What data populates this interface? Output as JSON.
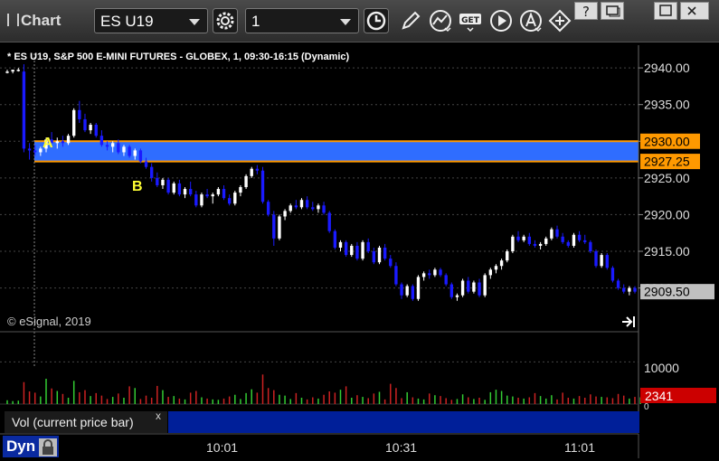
{
  "app": {
    "title": "Chart"
  },
  "toolbar": {
    "symbol": "ES U19",
    "interval": "1",
    "icons": [
      "gear-icon",
      "clock-icon",
      "pencil-icon",
      "line-study-icon",
      "get-icon",
      "play-icon",
      "a-alert-icon",
      "move-icon"
    ]
  },
  "window_controls": [
    "help-icon",
    "restore-icon",
    "maximize-icon",
    "close-icon"
  ],
  "chart": {
    "header": "* ES U19, S&P 500 E-MINI FUTURES - GLOBEX, 1, 09:30-16:15 (Dynamic)",
    "copyright": "© eSignal, 2019",
    "price_ticks": [
      "2940.00",
      "2935.00",
      "2930.00",
      "2925.00",
      "2920.00",
      "2915.00",
      "2910.00"
    ],
    "hline_upper": "2930.00",
    "hline_lower": "2927.25",
    "last_price": "2909.50",
    "annotation_a": "A",
    "annotation_b": "B",
    "time_ticks": [
      "10:01",
      "10:31",
      "11:01"
    ],
    "volume_tick": "10000",
    "volume_zero": "0",
    "last_volume": "2341",
    "volume_label": "Vol (current price bar)",
    "volume_close": "x",
    "dyn_label": "Dyn",
    "colors": {
      "up_candle": "#ffffff",
      "down_candle": "#1a1aff",
      "zone": "#2f6dff",
      "hline": "#ff9900",
      "vol_up": "#33cc33",
      "vol_down": "#cc2222",
      "last_price_badge": "#c0c0c0",
      "last_volume_badge": "#cc0000"
    }
  },
  "chart_data": {
    "type": "candlestick",
    "title": "* ES U19, S&P 500 E-MINI FUTURES - GLOBEX, 1, 09:30-16:15 (Dynamic)",
    "ylim": [
      2906.5,
      2941
    ],
    "price_ticks": [
      2910,
      2915,
      2920,
      2925,
      2930,
      2935,
      2940
    ],
    "horizontal_lines": [
      2930.0,
      2927.25
    ],
    "last_price": 2909.5,
    "time_ticks": [
      "10:01",
      "10:31",
      "11:01"
    ],
    "candles": [
      [
        2939.5,
        2939.75,
        2939.25,
        2939.5
      ],
      [
        2939.5,
        2939.75,
        2939.25,
        2939.75
      ],
      [
        2939.75,
        2940.0,
        2939.5,
        2939.75
      ],
      [
        2939.5,
        2940.5,
        2928.5,
        2929.0
      ],
      [
        2929.0,
        2929.75,
        2927.5,
        2928.75
      ],
      [
        2928.75,
        2929.5,
        2928.0,
        2928.5
      ],
      [
        2928.5,
        2929.25,
        2928.0,
        2929.0
      ],
      [
        2929.0,
        2930.5,
        2928.5,
        2930.25
      ],
      [
        2930.25,
        2931.25,
        2929.75,
        2929.75
      ],
      [
        2929.75,
        2930.5,
        2929.0,
        2930.0
      ],
      [
        2930.0,
        2930.75,
        2929.25,
        2929.75
      ],
      [
        2929.75,
        2931.0,
        2929.5,
        2930.75
      ],
      [
        2930.75,
        2934.5,
        2930.5,
        2934.25
      ],
      [
        2934.25,
        2935.5,
        2932.5,
        2933.0
      ],
      [
        2933.0,
        2933.75,
        2931.25,
        2931.5
      ],
      [
        2931.5,
        2932.5,
        2931.0,
        2932.25
      ],
      [
        2932.25,
        2932.5,
        2930.5,
        2930.75
      ],
      [
        2930.75,
        2931.5,
        2929.25,
        2929.5
      ],
      [
        2929.5,
        2930.0,
        2928.75,
        2929.25
      ],
      [
        2929.25,
        2930.0,
        2928.5,
        2929.75
      ],
      [
        2929.75,
        2930.25,
        2928.25,
        2928.5
      ],
      [
        2928.5,
        2929.5,
        2928.0,
        2929.25
      ],
      [
        2929.25,
        2929.5,
        2927.75,
        2928.0
      ],
      [
        2928.0,
        2929.0,
        2927.5,
        2928.75
      ],
      [
        2928.75,
        2929.0,
        2927.0,
        2927.25
      ],
      [
        2927.25,
        2927.75,
        2926.25,
        2926.5
      ],
      [
        2926.5,
        2927.0,
        2924.5,
        2925.0
      ],
      [
        2925.0,
        2925.75,
        2923.75,
        2924.0
      ],
      [
        2924.0,
        2925.0,
        2923.5,
        2924.75
      ],
      [
        2924.75,
        2925.0,
        2922.75,
        2923.0
      ],
      [
        2923.0,
        2924.5,
        2922.75,
        2924.25
      ],
      [
        2924.25,
        2924.75,
        2922.5,
        2922.75
      ],
      [
        2922.75,
        2923.75,
        2922.25,
        2923.5
      ],
      [
        2923.5,
        2924.5,
        2922.5,
        2922.75
      ],
      [
        2922.75,
        2923.25,
        2921.0,
        2921.25
      ],
      [
        2921.25,
        2923.0,
        2921.0,
        2922.75
      ],
      [
        2922.75,
        2923.5,
        2922.25,
        2922.5
      ],
      [
        2922.5,
        2923.0,
        2921.5,
        2922.75
      ],
      [
        2922.75,
        2923.75,
        2922.5,
        2923.5
      ],
      [
        2923.5,
        2924.0,
        2922.0,
        2922.25
      ],
      [
        2922.25,
        2922.75,
        2921.25,
        2921.5
      ],
      [
        2921.5,
        2923.25,
        2921.25,
        2923.0
      ],
      [
        2923.0,
        2924.0,
        2922.5,
        2923.75
      ],
      [
        2923.75,
        2925.5,
        2923.5,
        2925.25
      ],
      [
        2925.25,
        2926.5,
        2925.0,
        2926.25
      ],
      [
        2926.25,
        2926.75,
        2925.5,
        2926.0
      ],
      [
        2926.0,
        2926.5,
        2921.5,
        2921.75
      ],
      [
        2921.75,
        2922.0,
        2919.75,
        2920.0
      ],
      [
        2920.0,
        2920.5,
        2915.75,
        2916.75
      ],
      [
        2916.75,
        2920.0,
        2916.5,
        2919.75
      ],
      [
        2919.75,
        2920.75,
        2919.25,
        2920.5
      ],
      [
        2920.5,
        2921.5,
        2920.25,
        2921.25
      ],
      [
        2921.25,
        2922.0,
        2920.75,
        2921.0
      ],
      [
        2921.0,
        2922.25,
        2920.75,
        2922.0
      ],
      [
        2922.0,
        2922.5,
        2920.75,
        2921.0
      ],
      [
        2921.0,
        2921.75,
        2920.5,
        2920.75
      ],
      [
        2920.75,
        2921.5,
        2920.25,
        2921.25
      ],
      [
        2921.25,
        2921.75,
        2920.0,
        2920.25
      ],
      [
        2920.25,
        2920.5,
        2917.5,
        2917.75
      ],
      [
        2917.75,
        2918.0,
        2915.25,
        2915.5
      ],
      [
        2915.5,
        2916.5,
        2915.0,
        2916.25
      ],
      [
        2916.25,
        2916.5,
        2914.25,
        2914.5
      ],
      [
        2914.5,
        2916.0,
        2914.25,
        2915.75
      ],
      [
        2915.75,
        2916.25,
        2913.75,
        2914.0
      ],
      [
        2914.0,
        2916.5,
        2913.75,
        2916.25
      ],
      [
        2916.25,
        2916.75,
        2914.75,
        2915.0
      ],
      [
        2915.0,
        2915.5,
        2913.25,
        2913.5
      ],
      [
        2913.5,
        2915.75,
        2913.25,
        2915.5
      ],
      [
        2915.5,
        2916.0,
        2913.75,
        2914.0
      ],
      [
        2914.0,
        2914.5,
        2912.75,
        2913.0
      ],
      [
        2913.0,
        2913.5,
        2910.25,
        2910.5
      ],
      [
        2910.5,
        2910.75,
        2908.5,
        2909.0
      ],
      [
        2909.0,
        2910.5,
        2908.75,
        2910.25
      ],
      [
        2910.25,
        2910.5,
        2908.25,
        2908.5
      ],
      [
        2908.5,
        2911.75,
        2908.25,
        2911.5
      ],
      [
        2911.5,
        2912.25,
        2911.0,
        2912.0
      ],
      [
        2912.0,
        2912.5,
        2911.25,
        2911.75
      ],
      [
        2911.75,
        2912.75,
        2911.5,
        2912.5
      ],
      [
        2912.5,
        2912.75,
        2911.5,
        2911.75
      ],
      [
        2911.75,
        2912.0,
        2910.25,
        2910.5
      ],
      [
        2910.5,
        2910.75,
        2908.5,
        2908.75
      ],
      [
        2908.75,
        2909.25,
        2908.25,
        2909.0
      ],
      [
        2909.0,
        2911.25,
        2908.75,
        2911.0
      ],
      [
        2911.0,
        2911.5,
        2909.25,
        2909.5
      ],
      [
        2909.5,
        2911.0,
        2909.25,
        2910.75
      ],
      [
        2910.75,
        2911.25,
        2908.75,
        2909.0
      ],
      [
        2909.0,
        2912.0,
        2908.75,
        2911.75
      ],
      [
        2911.75,
        2912.75,
        2911.25,
        2912.5
      ],
      [
        2912.5,
        2913.25,
        2912.0,
        2913.0
      ],
      [
        2913.0,
        2914.0,
        2912.5,
        2913.75
      ],
      [
        2913.75,
        2915.25,
        2913.5,
        2915.0
      ],
      [
        2915.0,
        2917.25,
        2914.75,
        2917.0
      ],
      [
        2917.0,
        2917.75,
        2916.25,
        2916.5
      ],
      [
        2916.5,
        2917.25,
        2916.25,
        2917.0
      ],
      [
        2917.0,
        2917.5,
        2915.75,
        2916.0
      ],
      [
        2916.0,
        2916.5,
        2915.5,
        2915.75
      ],
      [
        2915.75,
        2916.25,
        2915.25,
        2916.0
      ],
      [
        2916.0,
        2917.0,
        2915.75,
        2916.75
      ],
      [
        2916.75,
        2918.25,
        2916.5,
        2918.0
      ],
      [
        2918.0,
        2918.5,
        2916.75,
        2917.0
      ],
      [
        2917.0,
        2917.5,
        2916.0,
        2916.25
      ],
      [
        2916.25,
        2916.5,
        2915.5,
        2915.75
      ],
      [
        2915.75,
        2917.5,
        2915.5,
        2917.25
      ],
      [
        2917.25,
        2917.75,
        2916.25,
        2916.5
      ],
      [
        2916.5,
        2917.25,
        2916.0,
        2916.25
      ],
      [
        2916.25,
        2916.5,
        2914.75,
        2915.0
      ],
      [
        2915.0,
        2915.25,
        2912.75,
        2913.0
      ],
      [
        2913.0,
        2914.75,
        2912.75,
        2914.5
      ],
      [
        2914.5,
        2914.75,
        2912.5,
        2912.75
      ],
      [
        2912.75,
        2913.0,
        2910.75,
        2911.0
      ],
      [
        2911.0,
        2911.25,
        2909.75,
        2910.0
      ],
      [
        2910.0,
        2910.5,
        2909.25,
        2909.5
      ],
      [
        2909.5,
        2910.25,
        2909.0,
        2910.0
      ],
      [
        2910.0,
        2910.25,
        2909.25,
        2909.5
      ]
    ],
    "volume": {
      "ylim": [
        0,
        15000
      ],
      "ticks": [
        10000
      ],
      "last": 2341,
      "values": [
        900,
        700,
        800,
        5200,
        3000,
        2700,
        1800,
        6000,
        3700,
        3100,
        2400,
        1500,
        5500,
        2800,
        3300,
        1900,
        2600,
        2000,
        1200,
        1700,
        2500,
        1500,
        4200,
        3800,
        1200,
        2000,
        1500,
        4300,
        3300,
        1700,
        1900,
        1300,
        1100,
        2700,
        3100,
        1600,
        1300,
        1100,
        1000,
        1300,
        1800,
        2200,
        1200,
        2600,
        3500,
        2700,
        7000,
        3800,
        3300,
        2200,
        2000,
        1200,
        2600,
        1500,
        1100,
        1600,
        1300,
        2200,
        3000,
        2700,
        3400,
        4200,
        1500,
        2100,
        1700,
        1400,
        2500,
        2900,
        1100,
        4800,
        3800,
        1400,
        2800,
        1600,
        1300,
        1100,
        2500,
        2100,
        1900,
        1400,
        1000,
        1200,
        2300,
        1600,
        1200,
        1500,
        1000,
        2800,
        3400,
        3100,
        2000,
        1800,
        1500,
        1300,
        1600,
        2600,
        1900,
        1300,
        2100,
        1100,
        2700,
        1500,
        1300,
        1900,
        1500,
        2300,
        1800,
        1700,
        1600,
        1400,
        2400,
        2000,
        1300,
        1700,
        1600
      ]
    }
  }
}
